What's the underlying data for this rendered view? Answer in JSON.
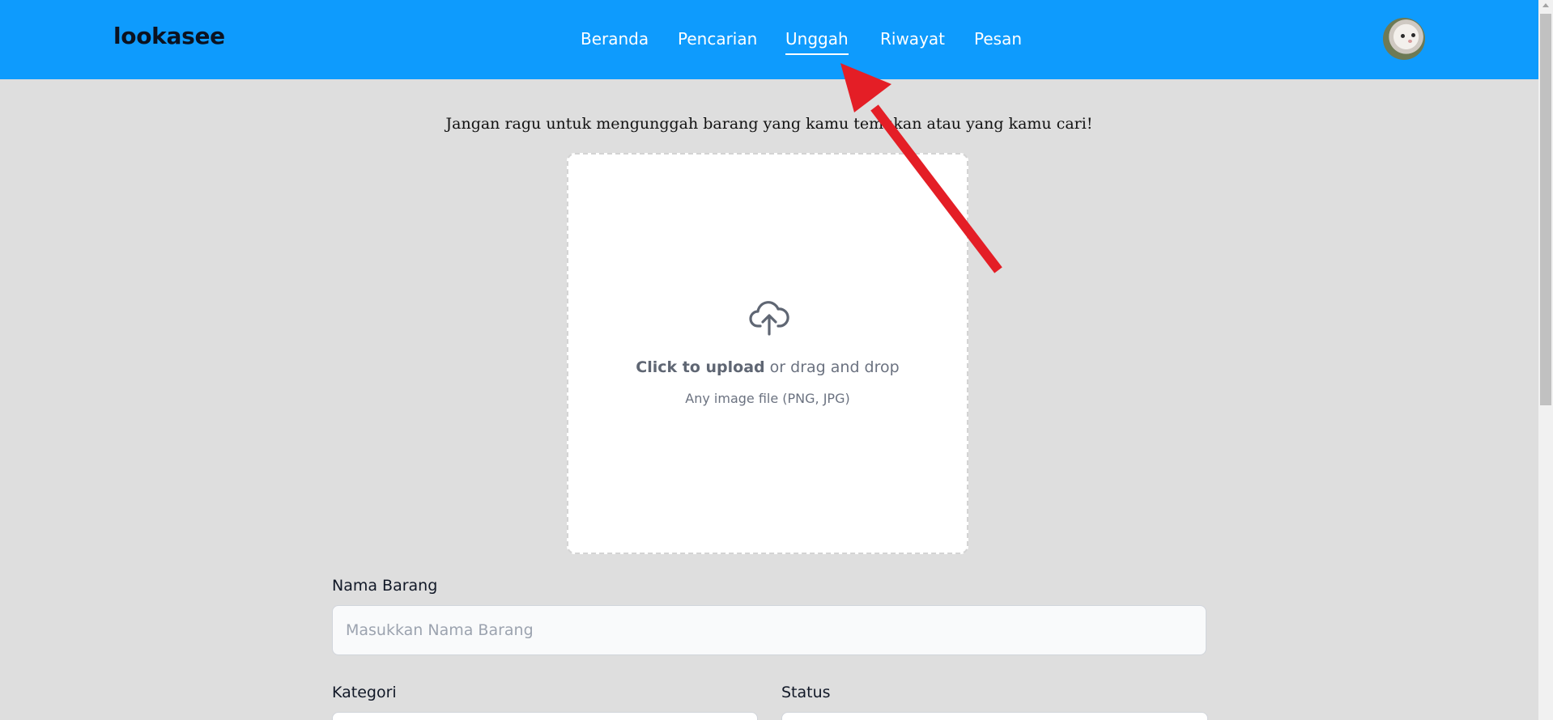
{
  "app": {
    "brand": "lookasee"
  },
  "nav": {
    "items": [
      {
        "label": "Beranda"
      },
      {
        "label": "Pencarian"
      },
      {
        "label": "Unggah",
        "active": true
      },
      {
        "label": "Riwayat"
      },
      {
        "label": "Pesan"
      }
    ]
  },
  "upload": {
    "intro": "Jangan ragu untuk mengunggah barang yang kamu temukan atau yang kamu cari!",
    "click_text": "Click to upload",
    "drag_text": " or drag and drop",
    "hint": "Any image file (PNG, JPG)",
    "icon": "cloud-upload-icon"
  },
  "form": {
    "name_label": "Nama Barang",
    "name_placeholder": "Masukkan Nama Barang",
    "category_label": "Kategori",
    "status_label": "Status"
  },
  "colors": {
    "navbar": "#0e9bfd",
    "background": "#dedede",
    "annotation_arrow": "#e41e26"
  }
}
